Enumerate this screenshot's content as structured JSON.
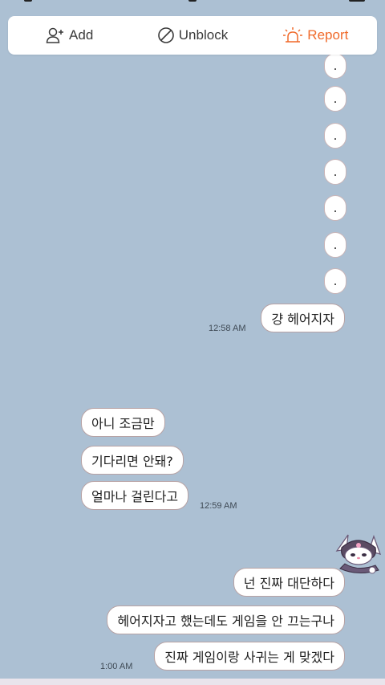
{
  "action_bar": {
    "add_label": "Add",
    "unblock_label": "Unblock",
    "report_label": "Report",
    "report_color": "#f06a2a"
  },
  "messages": {
    "dots": [
      ".",
      ".",
      ".",
      ".",
      ".",
      ".",
      "."
    ],
    "m1": {
      "text": "걍 헤어지자",
      "time": "12:58 AM"
    },
    "r1": {
      "text": "아니 조금만"
    },
    "r2": {
      "text": "기다리면 안돼?"
    },
    "r3": {
      "text": "얼마나 걸린다고",
      "time": "12:59 AM"
    },
    "m2": {
      "text": "넌 진짜 대단하다"
    },
    "m3": {
      "text": "헤어지자고 했는데도 게임을 안 끄는구나"
    },
    "m4": {
      "text": "진짜 게임이랑 사귀는 게 맞겠다",
      "time": "1:00 AM"
    }
  },
  "sticker": {
    "icon": "kuromi-sticker"
  },
  "colors": {
    "chat_background": "#acc0d3",
    "bubble_border": "#b7a2a4"
  }
}
